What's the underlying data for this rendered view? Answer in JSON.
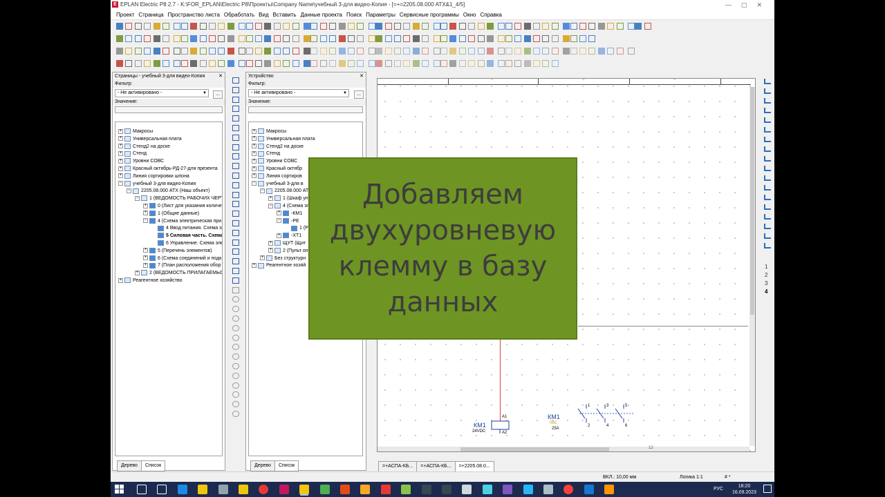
{
  "window": {
    "title": "EPLAN Electric P8 2.7 - K:\\FOR_EPLAN\\Electric P8\\Проекты\\Company Name\\учебный 3-для видео-Копия - [=+=2205.08.000 АТХ&1_4/5]",
    "app_badge": "E"
  },
  "menu": [
    "Проект",
    "Страница",
    "Пространство листа",
    "Обработать",
    "Вид",
    "Вставить",
    "Данные проекта",
    "Поиск",
    "Параметры",
    "Сервисные программы",
    "Окно",
    "Справка"
  ],
  "pages_panel": {
    "title": "Страницы - учебный 3-для видео-Копия",
    "filter_label": "Фильтр:",
    "filter_value": "- Не активировано -",
    "dots": "...",
    "value_label": "Значение:",
    "tree": [
      "Макросы",
      "Универсальная плата",
      "Стенд2 на доске",
      "Стенд",
      "Уровни СОВС",
      "Красный октябрь-РД-27-для презента",
      "Линия сортировки шпона",
      "учебный 3-для видео-Копия",
      "2205.08.000 АТХ (Наш объект)",
      "1 (ВЕДОМОСТЬ РАБОЧИХ ЧЕРТЕ",
      "0 (Лист для указания количе",
      "1 (Общие данные)",
      "4 (Схема электрическая  при",
      "4 Ввод питания. Схема эл",
      "5 Силовая часть. Схема",
      "6 Управление. Схема эле",
      "5 (Перечень элементов)",
      "6 (Схема соединений и подк",
      "7 (План расположения обор",
      "2 (ВЕДОМОСТЬ ПРИЛАГАЕМЫХ",
      "Реагентное хозяйство"
    ],
    "tab_tree": "Дерево",
    "tab_list": "Список"
  },
  "device_panel": {
    "title": "Устройство",
    "filter_label": "Фильтр:",
    "filter_value": "- Не активировано -",
    "dots": "...",
    "value_label": "Значение:",
    "tree": [
      "Макросы",
      "Универсальная плата",
      "Стенд2 на доске",
      "Стенд",
      "Уровни СОВС",
      "Красный октябр",
      "Линия сортиров",
      "учебный 3-для в",
      "2205.08.000 АТ",
      "1 (Шкаф упр",
      "4 (Схема эл",
      "-КМ1",
      "-РЕ",
      "1 (Р",
      "-ХТ1",
      "ЩУТ (Щит",
      "2 (Пульт оп",
      "Без структурн",
      "Реагентное хозяй"
    ],
    "tab_tree": "Дерево",
    "tab_list": "Список"
  },
  "overlay": {
    "line1": "Добавляем",
    "line2": "двухуровневую",
    "line3": "клемму в базу",
    "line4": "данных",
    "color": "#6e9423"
  },
  "schematic": {
    "col_numbers": [
      "",
      "0",
      "",
      "3",
      "",
      "4"
    ],
    "coil": {
      "tag": "КМ1",
      "voltage": "24VDC",
      "a1": "A1",
      "a2": "A2"
    },
    "contactor": {
      "tag": "КМ1",
      "sub": "06C",
      "rating": "25A",
      "pins_top": [
        "1",
        "3",
        "5"
      ],
      "pins_bottom": [
        "2",
        "4",
        "6"
      ]
    },
    "bottom_num": "12",
    "right_pages": [
      "1",
      "2",
      "3",
      "4"
    ]
  },
  "doc_tabs": [
    "=+АСПА-КБ...",
    "=+АСПА-КБ...",
    "=+2205.08.0..."
  ],
  "status": {
    "grid": "ВКЛ.: 10,00 мм",
    "logic": "Логика 1:1",
    "hash": "# *"
  },
  "tray": {
    "lang": "РУС",
    "time": "18:20",
    "date": "16.09.2023"
  }
}
